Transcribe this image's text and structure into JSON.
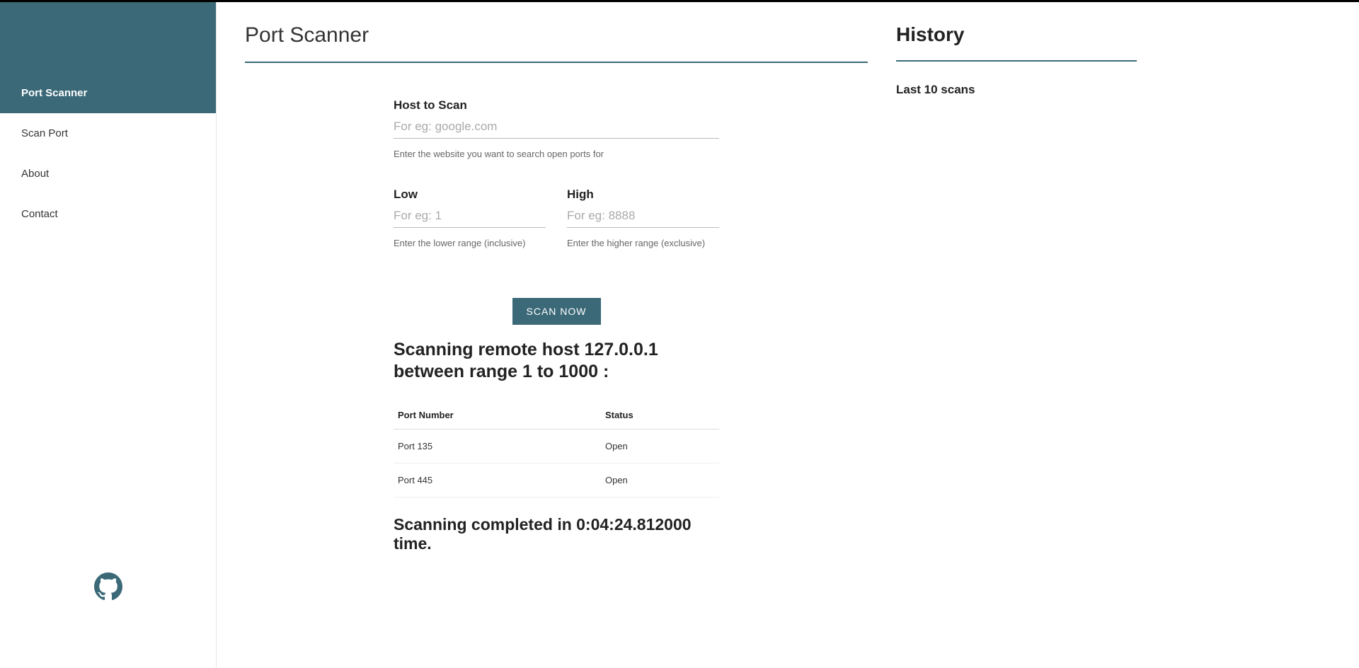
{
  "sidebar": {
    "items": [
      {
        "label": "Port Scanner",
        "active": true
      },
      {
        "label": "Scan Port",
        "active": false
      },
      {
        "label": "About",
        "active": false
      },
      {
        "label": "Contact",
        "active": false
      }
    ]
  },
  "main": {
    "title": "Port Scanner",
    "form": {
      "host": {
        "label": "Host to Scan",
        "placeholder": "For eg: google.com",
        "helper": "Enter the website you want to search open ports for",
        "value": ""
      },
      "low": {
        "label": "Low",
        "placeholder": "For eg: 1",
        "helper": "Enter the lower range (inclusive)",
        "value": ""
      },
      "high": {
        "label": "High",
        "placeholder": "For eg: 8888",
        "helper": "Enter the higher range (exclusive)",
        "value": ""
      },
      "submit_label": "SCAN NOW"
    },
    "result": {
      "heading": "Scanning remote host 127.0.0.1 between range 1 to 1000 :",
      "columns": {
        "port": "Port Number",
        "status": "Status"
      },
      "rows": [
        {
          "port": "Port 135",
          "status": "Open"
        },
        {
          "port": "Port 445",
          "status": "Open"
        }
      ],
      "completion": "Scanning completed in 0:04:24.812000 time."
    }
  },
  "history": {
    "title": "History",
    "subtitle": "Last 10 scans"
  }
}
